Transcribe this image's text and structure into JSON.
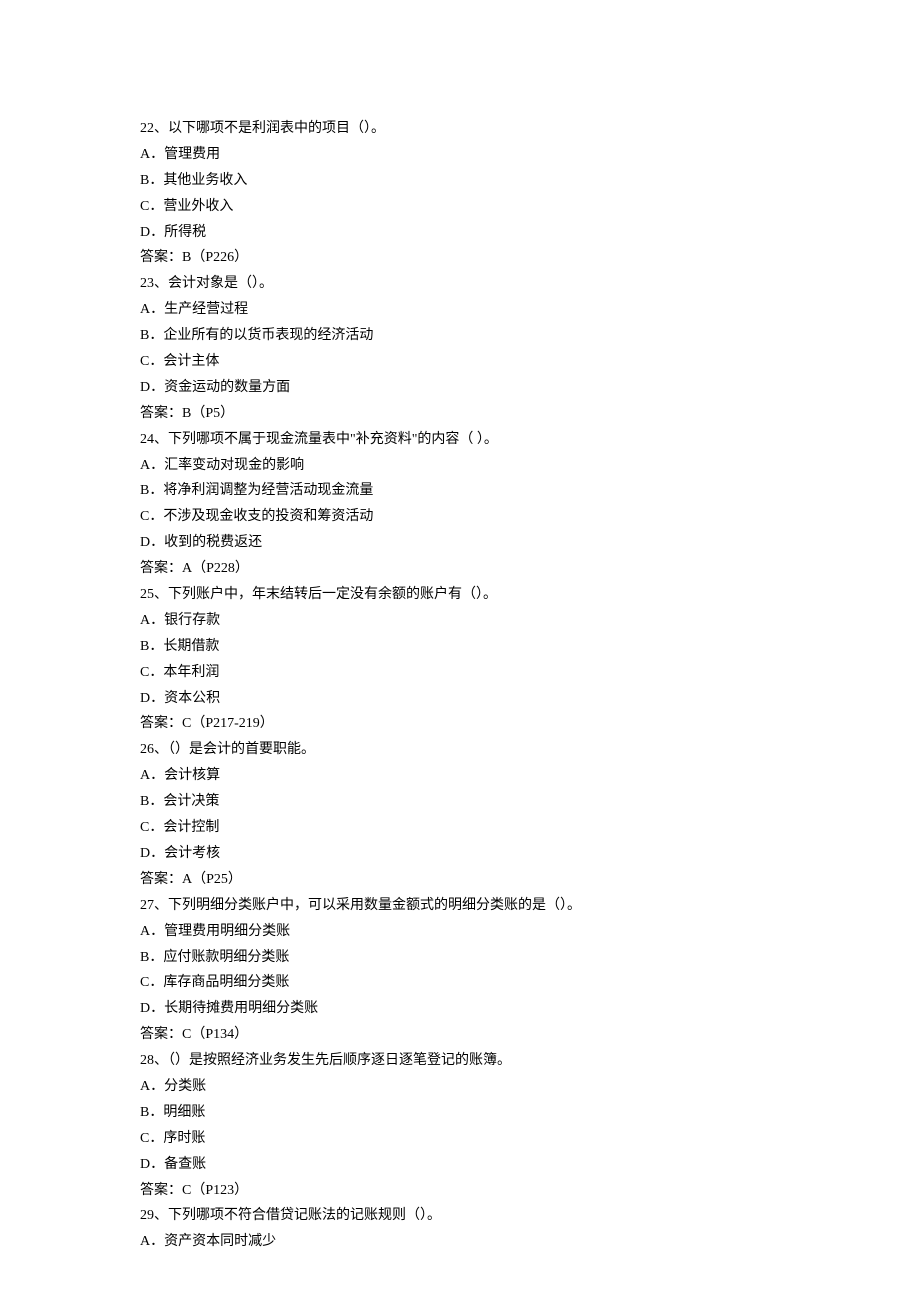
{
  "questions": [
    {
      "number": "22",
      "stem": "、以下哪项不是利润表中的项目（）。",
      "options": [
        {
          "label": "A．",
          "text": "管理费用"
        },
        {
          "label": "B．",
          "text": "其他业务收入"
        },
        {
          "label": "C．",
          "text": "营业外收入"
        },
        {
          "label": "D．",
          "text": "所得税"
        }
      ],
      "answer": "答案：B（P226）"
    },
    {
      "number": "23",
      "stem": "、会计对象是（）。",
      "options": [
        {
          "label": "A．",
          "text": "生产经营过程"
        },
        {
          "label": "B．",
          "text": "企业所有的以货币表现的经济活动"
        },
        {
          "label": "C．",
          "text": "会计主体"
        },
        {
          "label": "D．",
          "text": "资金运动的数量方面"
        }
      ],
      "answer": "答案：B（P5）"
    },
    {
      "number": "24",
      "stem": "、下列哪项不属于现金流量表中\"补充资料\"的内容（  ）。",
      "options": [
        {
          "label": "A．",
          "text": "汇率变动对现金的影响"
        },
        {
          "label": "B．",
          "text": "将净利润调整为经营活动现金流量"
        },
        {
          "label": "C．",
          "text": "不涉及现金收支的投资和筹资活动"
        },
        {
          "label": "D．",
          "text": "收到的税费返还"
        }
      ],
      "answer": "答案：A（P228）"
    },
    {
      "number": "25",
      "stem": "、下列账户中，年末结转后一定没有余额的账户有（）。",
      "options": [
        {
          "label": "A．",
          "text": "银行存款"
        },
        {
          "label": "B．",
          "text": "长期借款"
        },
        {
          "label": "C．",
          "text": "本年利润"
        },
        {
          "label": "D．",
          "text": "资本公积"
        }
      ],
      "answer": "答案：C（P217-219）"
    },
    {
      "number": "26",
      "stem": "、（）是会计的首要职能。",
      "options": [
        {
          "label": "A．",
          "text": "会计核算"
        },
        {
          "label": "B．",
          "text": "会计决策"
        },
        {
          "label": "C．",
          "text": "会计控制"
        },
        {
          "label": "D．",
          "text": "会计考核"
        }
      ],
      "answer": "答案：A（P25）"
    },
    {
      "number": "27",
      "stem": "、下列明细分类账户中，可以采用数量金额式的明细分类账的是（）。",
      "options": [
        {
          "label": "A．",
          "text": "管理费用明细分类账"
        },
        {
          "label": "B．",
          "text": "应付账款明细分类账"
        },
        {
          "label": "C．",
          "text": "库存商品明细分类账"
        },
        {
          "label": "D．",
          "text": "长期待摊费用明细分类账"
        }
      ],
      "answer": "答案：C（P134）"
    },
    {
      "number": "28",
      "stem": "、（）是按照经济业务发生先后顺序逐日逐笔登记的账簿。",
      "options": [
        {
          "label": "A．",
          "text": "分类账"
        },
        {
          "label": "B．",
          "text": "明细账"
        },
        {
          "label": "C．",
          "text": "序时账"
        },
        {
          "label": "D．",
          "text": "备查账"
        }
      ],
      "answer": "答案：C（P123）"
    },
    {
      "number": "29",
      "stem": "、下列哪项不符合借贷记账法的记账规则（）。",
      "options": [
        {
          "label": "A．",
          "text": "资产资本同时减少"
        }
      ],
      "answer": null
    }
  ]
}
